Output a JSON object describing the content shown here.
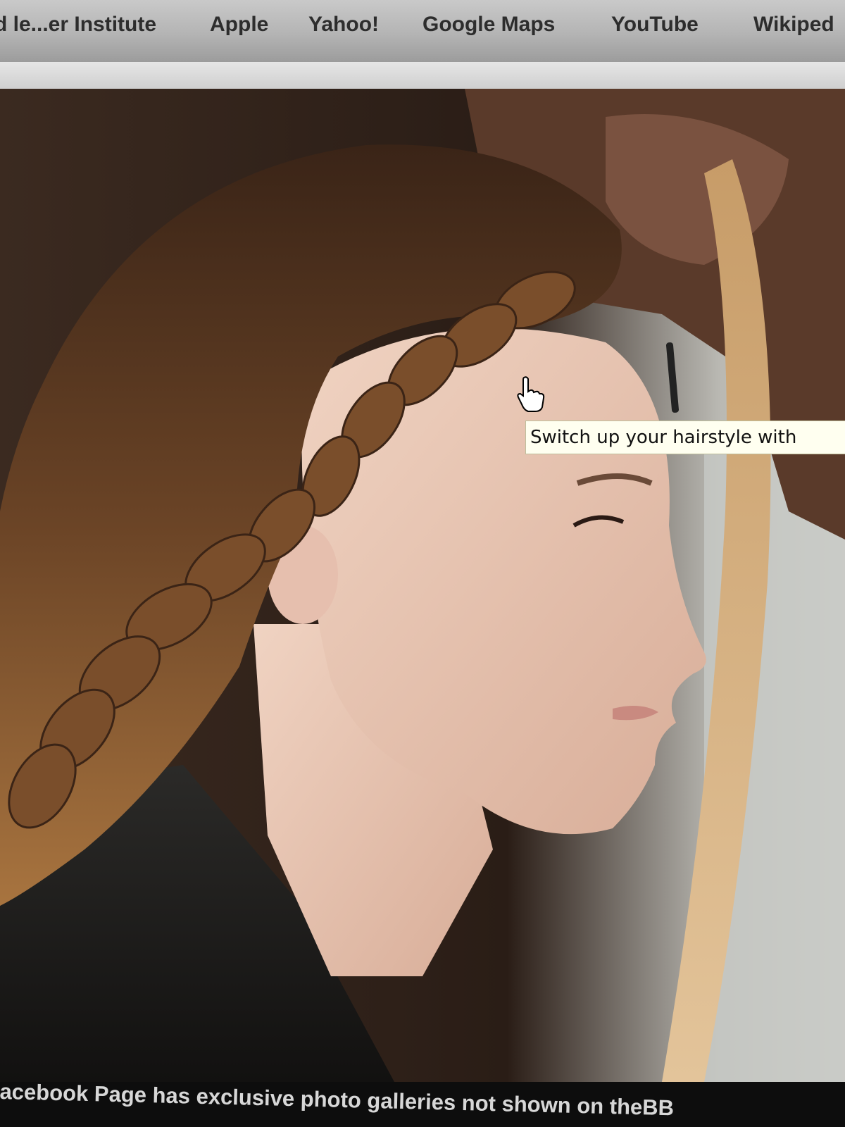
{
  "bookmarks": [
    {
      "label": "d le...er Institute"
    },
    {
      "label": "Apple"
    },
    {
      "label": "Yahoo!"
    },
    {
      "label": "Google Maps"
    },
    {
      "label": "YouTube"
    },
    {
      "label": "Wikiped"
    }
  ],
  "tooltip": {
    "text": "Switch up your hairstyle with"
  },
  "caption": {
    "text": "acebook Page has exclusive photo galleries not shown on theBB"
  },
  "photo": {
    "subject": "profile of woman with braided hair"
  }
}
